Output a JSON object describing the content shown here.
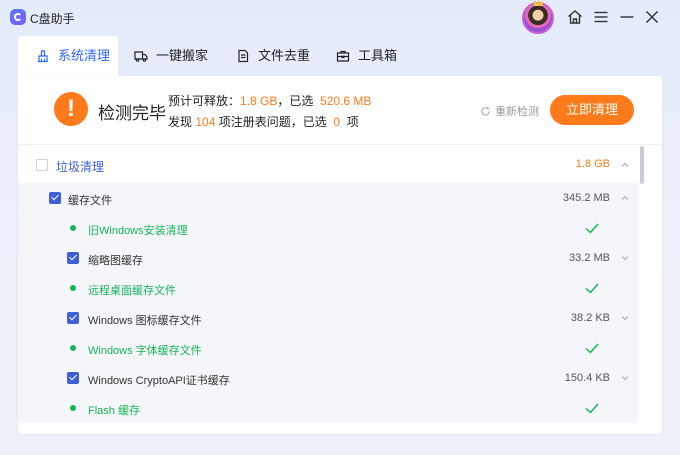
{
  "app": {
    "title": "C盘助手"
  },
  "tabs": [
    {
      "label": "系统清理",
      "icon": "broom-icon",
      "active": true
    },
    {
      "label": "一键搬家",
      "icon": "truck-icon",
      "active": false
    },
    {
      "label": "文件去重",
      "icon": "document-icon",
      "active": false
    },
    {
      "label": "工具箱",
      "icon": "toolbox-icon",
      "active": false
    }
  ],
  "summary": {
    "status": "检测完毕",
    "line1_prefix": "预计可释放：",
    "releasable": "1.8 GB",
    "line1_mid": "，已选",
    "selected_size": "520.6 MB",
    "line2_prefix": "发现",
    "issues_count": "104",
    "line2_mid": "项注册表问题，已选",
    "issues_selected": "0",
    "line2_suffix": "项",
    "rescan_label": "重新检测",
    "clean_label": "立即清理"
  },
  "list": {
    "group": {
      "label": "垃圾清理",
      "size": "1.8 GB",
      "checked": false
    },
    "subgroup": {
      "label": "缓存文件",
      "size": "345.2 MB",
      "checked": true
    },
    "items": [
      {
        "kind": "ok",
        "label": "旧Windows安装清理"
      },
      {
        "kind": "item",
        "label": "缩略图缓存",
        "size": "33.2 MB",
        "checked": true
      },
      {
        "kind": "ok",
        "label": "远程桌面缓存文件"
      },
      {
        "kind": "item",
        "label": "Windows 图标缓存文件",
        "size": "38.2 KB",
        "checked": true
      },
      {
        "kind": "ok",
        "label": "Windows 字体缓存文件"
      },
      {
        "kind": "item",
        "label": "Windows CryptoAPI证书缓存",
        "size": "150.4 KB",
        "checked": true
      },
      {
        "kind": "ok",
        "label": "Flash 缓存"
      }
    ]
  },
  "colors": {
    "accent": "#2f6bff",
    "orange": "#ff7a1a",
    "green": "#17b45a",
    "checkbox": "#3f5fd6"
  }
}
